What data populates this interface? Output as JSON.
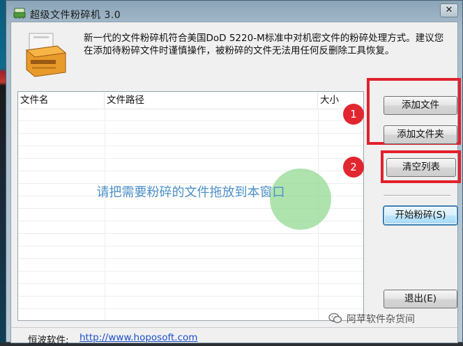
{
  "window": {
    "title": "超级文件粉碎机  3.0",
    "close_glyph": "✕"
  },
  "description": "新一代的文件粉碎机符合美国DoD 5220-M标准中对机密文件的粉碎处理方式。建议您在添加待粉碎文件时谨慎操作，被粉碎的文件无法用任何反删除工具恢复。",
  "list": {
    "columns": [
      "文件名",
      "文件路径",
      "大小"
    ],
    "drop_hint": "请把需要粉碎的文件拖放到本窗口"
  },
  "buttons": {
    "add_file": "添加文件",
    "add_folder": "添加文件夹",
    "clear_list": "清空列表",
    "start_shred": "开始粉碎(S)",
    "exit": "退出(E)"
  },
  "annotations": {
    "badge1": "1",
    "badge2": "2",
    "highlight_color": "#e2202c"
  },
  "footer": {
    "label": "恒波软件:",
    "link": "http://www.hoposoft.com"
  },
  "watermark": "阿苹软件杂货间",
  "icons": [
    "app-shredder-icon",
    "title-app-icon",
    "close-icon",
    "wechat-icon"
  ]
}
